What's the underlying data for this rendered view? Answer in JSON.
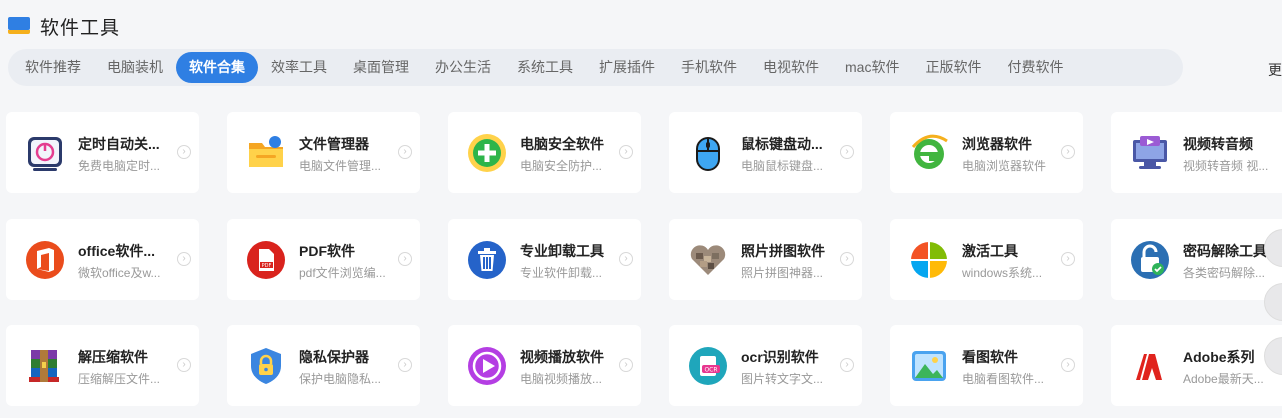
{
  "header": {
    "title": "软件工具"
  },
  "tabs": [
    {
      "label": "软件推荐"
    },
    {
      "label": "电脑装机"
    },
    {
      "label": "软件合集",
      "active": true
    },
    {
      "label": "效率工具"
    },
    {
      "label": "桌面管理"
    },
    {
      "label": "办公生活"
    },
    {
      "label": "系统工具"
    },
    {
      "label": "扩展插件"
    },
    {
      "label": "手机软件"
    },
    {
      "label": "电视软件"
    },
    {
      "label": "mac软件"
    },
    {
      "label": "正版软件"
    },
    {
      "label": "付费软件"
    }
  ],
  "more_label": "更",
  "cards": [
    {
      "name": "定时自动关...",
      "desc": "免费电脑定时...",
      "icon": "power-timer-icon"
    },
    {
      "name": "文件管理器",
      "desc": "电脑文件管理...",
      "icon": "folder-icon"
    },
    {
      "name": "电脑安全软件",
      "desc": "电脑安全防护...",
      "icon": "security-plus-icon"
    },
    {
      "name": "鼠标键盘动...",
      "desc": "电脑鼠标键盘...",
      "icon": "mouse-icon"
    },
    {
      "name": "浏览器软件",
      "desc": "电脑浏览器软件",
      "icon": "browser-e-icon"
    },
    {
      "name": "视频转音频",
      "desc": "视频转音频 视...",
      "icon": "video-monitor-icon"
    },
    {
      "name": "office软件...",
      "desc": "微软office及w...",
      "icon": "office-icon"
    },
    {
      "name": "PDF软件",
      "desc": "pdf文件浏览编...",
      "icon": "pdf-icon"
    },
    {
      "name": "专业卸载工具",
      "desc": "专业软件卸载...",
      "icon": "trash-icon"
    },
    {
      "name": "照片拼图软件",
      "desc": "照片拼图神器...",
      "icon": "heart-collage-icon"
    },
    {
      "name": "激活工具",
      "desc": "windows系统...",
      "icon": "windows-icon"
    },
    {
      "name": "密码解除工具",
      "desc": "各类密码解除...",
      "icon": "unlock-icon"
    },
    {
      "name": "解压缩软件",
      "desc": "压缩解压文件...",
      "icon": "archive-icon"
    },
    {
      "name": "隐私保护器",
      "desc": "保护电脑隐私...",
      "icon": "shield-lock-icon"
    },
    {
      "name": "视频播放软件",
      "desc": "电脑视频播放...",
      "icon": "play-icon"
    },
    {
      "name": "ocr识别软件",
      "desc": "图片转文字文...",
      "icon": "ocr-icon"
    },
    {
      "name": "看图软件",
      "desc": "电脑看图软件...",
      "icon": "image-viewer-icon"
    },
    {
      "name": "Adobe系列",
      "desc": "Adobe最新天...",
      "icon": "adobe-icon"
    }
  ]
}
